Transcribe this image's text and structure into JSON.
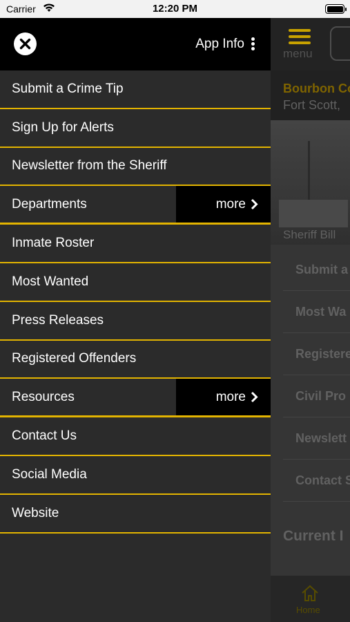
{
  "status_bar": {
    "carrier": "Carrier",
    "time": "12:20 PM"
  },
  "drawer": {
    "close_icon": "close-icon",
    "app_info_label": "App Info",
    "menu_items": [
      {
        "label": "Submit a Crime Tip"
      },
      {
        "label": "Sign Up for Alerts"
      },
      {
        "label": "Newsletter from the Sheriff"
      },
      {
        "label": "Departments",
        "more": "more"
      },
      {
        "label": "Inmate Roster"
      },
      {
        "label": "Most Wanted"
      },
      {
        "label": "Press Releases"
      },
      {
        "label": "Registered Offenders"
      },
      {
        "label": "Resources",
        "more": "more"
      },
      {
        "label": "Contact Us"
      },
      {
        "label": "Social Media"
      },
      {
        "label": "Website"
      }
    ]
  },
  "background": {
    "menu_label": "menu",
    "org_name": "Bourbon Co",
    "location": "Fort Scott,",
    "photo_caption": "Sheriff Bill",
    "list": [
      "Submit a",
      "Most Wa",
      "Registere",
      "Civil Pro",
      "Newslett",
      "Contact S"
    ],
    "section_title": "Current I",
    "tab_home": "Home"
  },
  "colors": {
    "accent": "#e3b400",
    "drawer_bg": "#2b2b2b",
    "header_bg": "#000000"
  }
}
